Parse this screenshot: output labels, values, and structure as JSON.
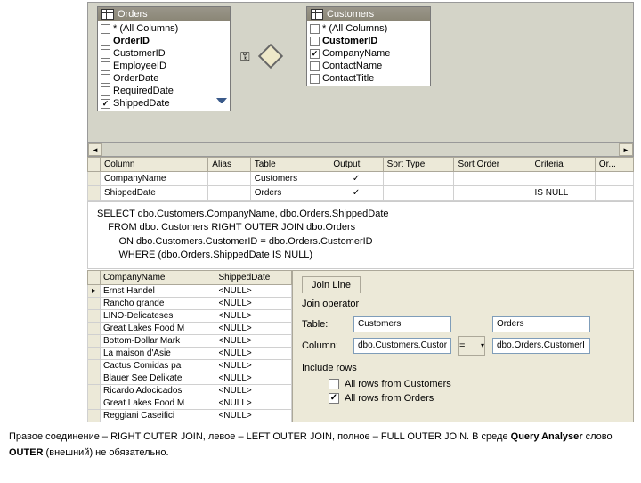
{
  "designer": {
    "tables": {
      "orders": {
        "title": "Orders",
        "columns": [
          {
            "name": "* (All Columns)",
            "checked": false
          },
          {
            "name": "OrderID",
            "checked": false,
            "bold": true
          },
          {
            "name": "CustomerID",
            "checked": false
          },
          {
            "name": "EmployeeID",
            "checked": false
          },
          {
            "name": "OrderDate",
            "checked": false
          },
          {
            "name": "RequiredDate",
            "checked": false
          },
          {
            "name": "ShippedDate",
            "checked": true,
            "filter": true
          }
        ]
      },
      "customers": {
        "title": "Customers",
        "columns": [
          {
            "name": "* (All Columns)",
            "checked": false
          },
          {
            "name": "CustomerID",
            "checked": false,
            "bold": true
          },
          {
            "name": "CompanyName",
            "checked": true
          },
          {
            "name": "ContactName",
            "checked": false
          },
          {
            "name": "ContactTitle",
            "checked": false
          }
        ]
      }
    }
  },
  "grid": {
    "headers": [
      "Column",
      "Alias",
      "Table",
      "Output",
      "Sort Type",
      "Sort Order",
      "Criteria",
      "Or..."
    ],
    "rows": [
      {
        "column": "CompanyName",
        "alias": "",
        "table": "Customers",
        "output": "✓",
        "sortType": "",
        "sortOrder": "",
        "criteria": "",
        "or": ""
      },
      {
        "column": "ShippedDate",
        "alias": "",
        "table": "Orders",
        "output": "✓",
        "sortType": "",
        "sortOrder": "",
        "criteria": "IS NULL",
        "or": ""
      }
    ]
  },
  "sql": {
    "line1": "SELECT dbo.Customers.CompanyName, dbo.Orders.ShippedDate",
    "line2": "    FROM dbo. Customers RIGHT OUTER JOIN dbo.Orders",
    "line3": "        ON dbo.Customers.CustomerID = dbo.Orders.CustomerID",
    "line4": "        WHERE (dbo.Orders.ShippedDate IS NULL)"
  },
  "results": {
    "headers": [
      "CompanyName",
      "ShippedDate"
    ],
    "rows": [
      {
        "c1": "Ernst Handel",
        "c2": "<NULL>"
      },
      {
        "c1": "Rancho grande",
        "c2": "<NULL>"
      },
      {
        "c1": "LINO-Delicateses",
        "c2": "<NULL>"
      },
      {
        "c1": "Great Lakes Food M",
        "c2": "<NULL>"
      },
      {
        "c1": "Bottom-Dollar Mark",
        "c2": "<NULL>"
      },
      {
        "c1": "La maison d'Asie",
        "c2": "<NULL>"
      },
      {
        "c1": "Cactus Comidas pa",
        "c2": "<NULL>"
      },
      {
        "c1": "Blauer See Delikate",
        "c2": "<NULL>"
      },
      {
        "c1": "Ricardo Adocicados",
        "c2": "<NULL>"
      },
      {
        "c1": "Great Lakes Food M",
        "c2": "<NULL>"
      },
      {
        "c1": "Reggiani Caseifici",
        "c2": "<NULL>"
      }
    ]
  },
  "joinProps": {
    "tabLabel": "Join Line",
    "operatorLabel": "Join operator",
    "tableLabel": "Table:",
    "columnLabel": "Column:",
    "leftTable": "Customers",
    "rightTable": "Orders",
    "leftColumn": "dbo.Customers.Custor",
    "rightColumn": "dbo.Orders.CustomerI",
    "operator": "=",
    "includeLabel": "Include rows",
    "includeLeft": "All rows from Customers",
    "includeRight": "All rows from Orders"
  },
  "footer": {
    "t1": "Правое соединение – RIGHT OUTER JOIN, левое – LEFT OUTER JOIN, полное – FULL OUTER JOIN. В среде ",
    "t2": "Query Analyser",
    "t3": " слово ",
    "t4": "OUTER",
    "t5": " (внешний) не обязательно."
  }
}
